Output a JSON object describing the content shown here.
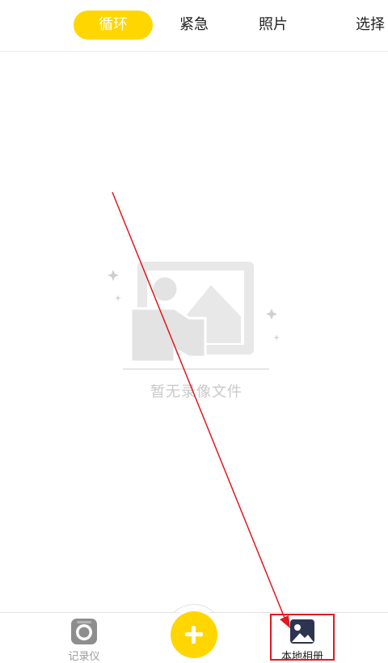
{
  "tabs": {
    "loop": "循环",
    "emergency": "紧急",
    "photo": "照片",
    "select": "选择"
  },
  "empty_state": {
    "message": "暂无录像文件"
  },
  "bottom_nav": {
    "recorder_label": "记录仪",
    "album_label": "本地相册"
  },
  "colors": {
    "accent": "#ffd600",
    "annotation": "#e0191f",
    "album_icon": "#2d3450"
  },
  "icons": {
    "recorder": "camera-icon",
    "add": "plus-icon",
    "album": "image-gallery-icon"
  }
}
